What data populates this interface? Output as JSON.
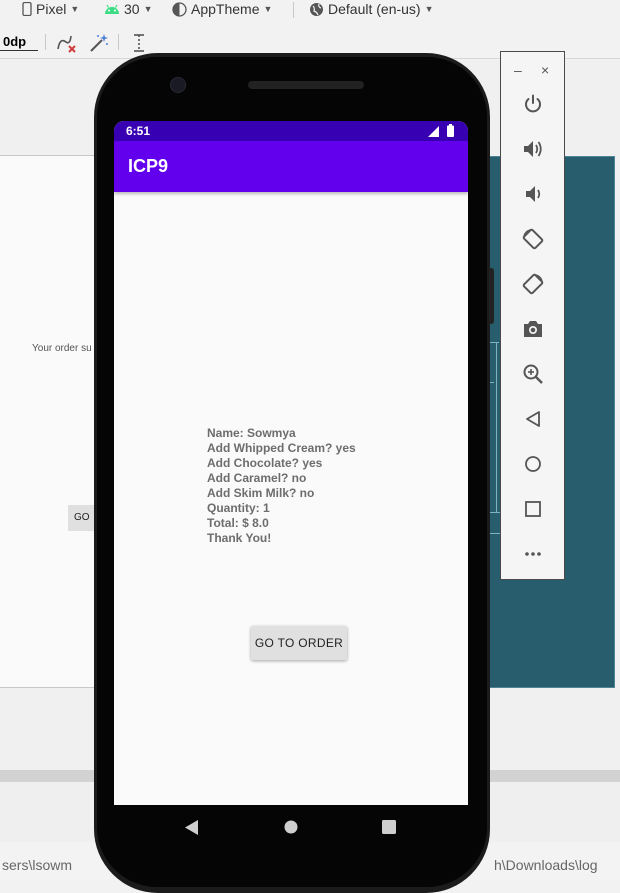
{
  "ide": {
    "toolbar": {
      "device_label": "Pixel",
      "api_label": "30",
      "theme_label": "AppTheme",
      "locale_label": "Default (en-us)",
      "margin_value": "0dp"
    },
    "preview": {
      "order_summary_text": "Your order su",
      "go_button_label": "GO T"
    },
    "bottom": {
      "left_text": "sers\\lsowm",
      "right_text": "h\\Downloads\\log"
    },
    "colors": {
      "blueprint": "#275d6d",
      "accent_green": "#3ddc84"
    }
  },
  "emulator": {
    "status_time": "6:51",
    "app_title": "ICP9",
    "summary_lines": [
      "Name: Sowmya",
      "Add Whipped Cream? yes",
      "Add Chocolate? yes",
      "Add Caramel? no",
      "Add Skim Milk? no",
      "Quantity: 1",
      "Total: $ 8.0",
      "Thank You!"
    ],
    "go_to_order_label": "GO TO ORDER",
    "colors": {
      "status_bar": "#3700b3",
      "app_bar": "#6200ee"
    },
    "controls": {
      "minimize": "–",
      "close": "×",
      "icons": [
        "power-icon",
        "volume-up-icon",
        "volume-down-icon",
        "rotate-left-icon",
        "rotate-right-icon",
        "camera-icon",
        "zoom-icon",
        "back-icon",
        "home-icon",
        "overview-icon",
        "more-icon"
      ]
    }
  }
}
